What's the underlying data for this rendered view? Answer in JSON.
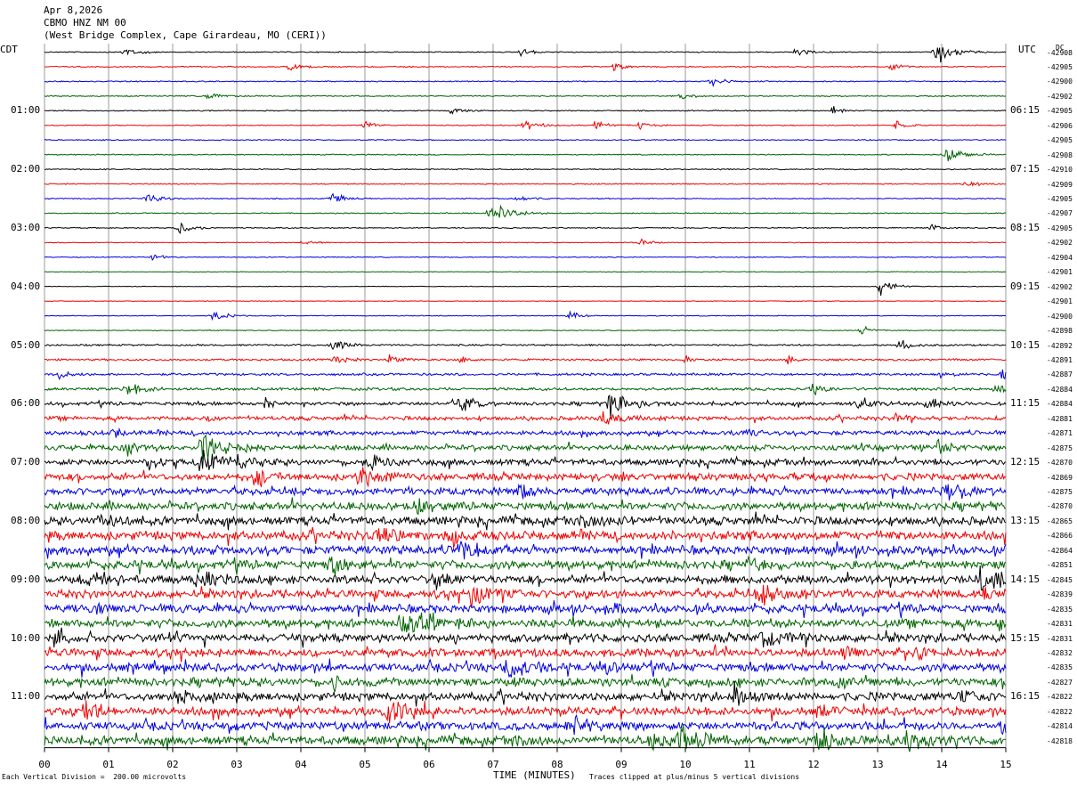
{
  "header": {
    "date": "Apr 8,2026",
    "station": "CBMO HNZ NM 00",
    "location": "(West Bridge Complex, Cape Girardeau, MO (CERI))"
  },
  "labels": {
    "left_tz": "CDT",
    "right_tz": "UTC",
    "dc_header": "DC",
    "xlabel": "TIME (MINUTES)",
    "scale_note": "Each Vertical Division =  200.00 microvolts",
    "clip_note": "Traces clipped at plus/minus 5 vertical divisions"
  },
  "chart_data": {
    "type": "helicorder",
    "xlim": [
      0,
      15
    ],
    "x_ticks": [
      "00",
      "01",
      "02",
      "03",
      "04",
      "05",
      "06",
      "07",
      "08",
      "09",
      "10",
      "11",
      "12",
      "13",
      "14",
      "15"
    ],
    "left_time_labels": [
      "01:00",
      "02:00",
      "03:00",
      "04:00",
      "05:00",
      "06:00",
      "07:00",
      "08:00",
      "09:00",
      "10:00",
      "11:00"
    ],
    "right_time_labels": [
      "06:15",
      "07:15",
      "08:15",
      "09:15",
      "10:15",
      "11:15",
      "12:15",
      "13:15",
      "14:15",
      "15:15",
      "16:15"
    ],
    "trace_colors": [
      "#000000",
      "#ee0000",
      "#0000dd",
      "#006400"
    ],
    "dc_offsets": [
      "-42908",
      "-42905",
      "-42900",
      "-42902",
      "-42905",
      "-42906",
      "-42905",
      "-42908",
      "-42910",
      "-42909",
      "-42905",
      "-42907",
      "-42905",
      "-42902",
      "-42904",
      "-42901",
      "-42902",
      "-42901",
      "-42900",
      "-42898",
      "-42892",
      "-42891",
      "-42887",
      "-42884",
      "-42884",
      "-42881",
      "-42871",
      "-42875",
      "-42870",
      "-42869",
      "-42875",
      "-42870",
      "-42865",
      "-42866",
      "-42864",
      "-42851",
      "-42845",
      "-42839",
      "-42835",
      "-42831",
      "-42831",
      "-42832",
      "-42835",
      "-42827",
      "-42822",
      "-42822",
      "-42814",
      "-42818"
    ],
    "row_activity": [
      0.5,
      0.5,
      0.5,
      0.5,
      0.5,
      0.5,
      0.5,
      0.5,
      0.5,
      0.5,
      0.5,
      0.5,
      0.5,
      0.4,
      0.4,
      0.3,
      0.3,
      0.3,
      0.4,
      0.4,
      0.8,
      0.9,
      1.1,
      1.3,
      1.6,
      1.8,
      2.0,
      2.4,
      2.8,
      3.2,
      3.4,
      3.6,
      3.8,
      4.0,
      4.0,
      4.0,
      3.8,
      3.8,
      3.8,
      3.8,
      3.8,
      3.8,
      3.8,
      3.8,
      3.8,
      3.8,
      3.8,
      4.0
    ],
    "events": [
      {
        "row": 0,
        "x": 1.27,
        "amp": 2,
        "dur": 0.15
      },
      {
        "row": 0,
        "x": 7.45,
        "amp": 1.8,
        "dur": 0.15
      },
      {
        "row": 0,
        "x": 11.75,
        "amp": 1.8,
        "dur": 0.15
      },
      {
        "row": 0,
        "x": 13.95,
        "amp": 5,
        "dur": 0.2
      },
      {
        "row": 1,
        "x": 3.85,
        "amp": 2,
        "dur": 0.15
      },
      {
        "row": 1,
        "x": 8.9,
        "amp": 2,
        "dur": 0.12
      },
      {
        "row": 1,
        "x": 13.2,
        "amp": 1.6,
        "dur": 0.12
      },
      {
        "row": 2,
        "x": 10.4,
        "amp": 2,
        "dur": 0.15
      },
      {
        "row": 3,
        "x": 2.55,
        "amp": 2,
        "dur": 0.12
      },
      {
        "row": 3,
        "x": 9.95,
        "amp": 2,
        "dur": 0.12
      },
      {
        "row": 4,
        "x": 6.35,
        "amp": 1.5,
        "dur": 0.15
      },
      {
        "row": 4,
        "x": 12.3,
        "amp": 1.8,
        "dur": 0.1
      },
      {
        "row": 5,
        "x": 5.0,
        "amp": 2,
        "dur": 0.12
      },
      {
        "row": 5,
        "x": 7.5,
        "amp": 2.5,
        "dur": 0.15
      },
      {
        "row": 5,
        "x": 8.6,
        "amp": 2.4,
        "dur": 0.12
      },
      {
        "row": 5,
        "x": 9.3,
        "amp": 2,
        "dur": 0.12
      },
      {
        "row": 5,
        "x": 13.3,
        "amp": 1.8,
        "dur": 0.12
      },
      {
        "row": 7,
        "x": 14.1,
        "amp": 3.5,
        "dur": 0.2
      },
      {
        "row": 9,
        "x": 14.4,
        "amp": 1.5,
        "dur": 0.15
      },
      {
        "row": 10,
        "x": 1.6,
        "amp": 2.5,
        "dur": 0.15
      },
      {
        "row": 10,
        "x": 4.5,
        "amp": 2.2,
        "dur": 0.15
      },
      {
        "row": 10,
        "x": 7.4,
        "amp": 1.5,
        "dur": 0.15
      },
      {
        "row": 11,
        "x": 7.0,
        "amp": 5,
        "dur": 0.22
      },
      {
        "row": 12,
        "x": 2.1,
        "amp": 3,
        "dur": 0.15
      },
      {
        "row": 12,
        "x": 13.85,
        "amp": 1.5,
        "dur": 0.1
      },
      {
        "row": 13,
        "x": 4.05,
        "amp": 1.5,
        "dur": 0.12
      },
      {
        "row": 13,
        "x": 9.3,
        "amp": 2,
        "dur": 0.12
      },
      {
        "row": 14,
        "x": 1.7,
        "amp": 1.5,
        "dur": 0.12
      },
      {
        "row": 16,
        "x": 13.05,
        "amp": 4,
        "dur": 0.15
      },
      {
        "row": 18,
        "x": 2.65,
        "amp": 2,
        "dur": 0.15
      },
      {
        "row": 18,
        "x": 8.2,
        "amp": 2,
        "dur": 0.12
      },
      {
        "row": 19,
        "x": 12.75,
        "amp": 2,
        "dur": 0.12
      },
      {
        "row": 20,
        "x": 4.5,
        "amp": 2.5,
        "dur": 0.15
      },
      {
        "row": 20,
        "x": 13.35,
        "amp": 2.5,
        "dur": 0.15
      },
      {
        "row": 21,
        "x": 4.55,
        "amp": 2,
        "dur": 0.15
      },
      {
        "row": 21,
        "x": 5.4,
        "amp": 2.2,
        "dur": 0.12
      },
      {
        "row": 21,
        "x": 6.5,
        "amp": 1.5,
        "dur": 0.1
      },
      {
        "row": 21,
        "x": 10.0,
        "amp": 1.5,
        "dur": 0.1
      },
      {
        "row": 21,
        "x": 11.6,
        "amp": 1.8,
        "dur": 0.1
      },
      {
        "row": 22,
        "x": 0.25,
        "amp": 2,
        "dur": 0.12
      },
      {
        "row": 22,
        "x": 14.0,
        "amp": 2,
        "dur": 0.1
      },
      {
        "row": 22,
        "x": 14.95,
        "amp": 2.2,
        "dur": 0.1
      },
      {
        "row": 23,
        "x": 1.3,
        "amp": 2.5,
        "dur": 0.2
      },
      {
        "row": 23,
        "x": 12.0,
        "amp": 2.2,
        "dur": 0.12
      },
      {
        "row": 23,
        "x": 14.85,
        "amp": 2,
        "dur": 0.12
      },
      {
        "row": 24,
        "x": 3.45,
        "amp": 2.2,
        "dur": 0.1
      },
      {
        "row": 24,
        "x": 6.45,
        "amp": 4,
        "dur": 0.2
      },
      {
        "row": 24,
        "x": 8.85,
        "amp": 5,
        "dur": 0.25
      },
      {
        "row": 24,
        "x": 12.7,
        "amp": 2,
        "dur": 0.15
      },
      {
        "row": 24,
        "x": 13.8,
        "amp": 3,
        "dur": 0.15
      },
      {
        "row": 25,
        "x": 2.55,
        "amp": 2,
        "dur": 0.1
      },
      {
        "row": 25,
        "x": 8.7,
        "amp": 2.5,
        "dur": 0.25
      },
      {
        "row": 25,
        "x": 13.3,
        "amp": 1.6,
        "dur": 0.1
      },
      {
        "row": 26,
        "x": 1.1,
        "amp": 2,
        "dur": 0.12
      },
      {
        "row": 26,
        "x": 10.95,
        "amp": 2.2,
        "dur": 0.12
      },
      {
        "row": 27,
        "x": 1.3,
        "amp": 3,
        "dur": 0.2
      },
      {
        "row": 27,
        "x": 2.5,
        "amp": 5,
        "dur": 0.25
      },
      {
        "row": 27,
        "x": 13.95,
        "amp": 3,
        "dur": 0.12
      },
      {
        "row": 28,
        "x": 2.45,
        "amp": 5,
        "dur": 0.3
      },
      {
        "row": 28,
        "x": 1.65,
        "amp": 3,
        "dur": 0.12
      },
      {
        "row": 28,
        "x": 5.05,
        "amp": 3,
        "dur": 0.2
      },
      {
        "row": 28,
        "x": 3.0,
        "amp": 2.5,
        "dur": 0.12
      },
      {
        "row": 29,
        "x": 4.95,
        "amp": 4,
        "dur": 0.2
      },
      {
        "row": 29,
        "x": 3.3,
        "amp": 3,
        "dur": 0.15
      },
      {
        "row": 30,
        "x": 14.1,
        "amp": 5,
        "dur": 0.2
      },
      {
        "row": 30,
        "x": 7.45,
        "amp": 2.5,
        "dur": 0.15
      },
      {
        "row": 31,
        "x": 5.8,
        "amp": 4,
        "dur": 0.15
      },
      {
        "row": 32,
        "x": 8.4,
        "amp": 3,
        "dur": 0.2
      },
      {
        "row": 32,
        "x": 0.9,
        "amp": 2.5,
        "dur": 0.15
      },
      {
        "row": 33,
        "x": 5.2,
        "amp": 5,
        "dur": 0.2
      },
      {
        "row": 33,
        "x": 6.3,
        "amp": 3,
        "dur": 0.15
      },
      {
        "row": 34,
        "x": 6.55,
        "amp": 4,
        "dur": 0.25
      },
      {
        "row": 35,
        "x": 4.5,
        "amp": 3,
        "dur": 0.15
      },
      {
        "row": 35,
        "x": 11.0,
        "amp": 3,
        "dur": 0.15
      },
      {
        "row": 36,
        "x": 0.7,
        "amp": 3,
        "dur": 0.15
      },
      {
        "row": 36,
        "x": 2.4,
        "amp": 3.5,
        "dur": 0.2
      },
      {
        "row": 36,
        "x": 6.1,
        "amp": 3,
        "dur": 0.15
      },
      {
        "row": 36,
        "x": 14.6,
        "amp": 4,
        "dur": 0.2
      },
      {
        "row": 37,
        "x": 6.7,
        "amp": 5,
        "dur": 0.2
      },
      {
        "row": 37,
        "x": 11.2,
        "amp": 4,
        "dur": 0.25
      },
      {
        "row": 37,
        "x": 14.6,
        "amp": 3,
        "dur": 0.12
      },
      {
        "row": 38,
        "x": 8.85,
        "amp": 2.5,
        "dur": 0.15
      },
      {
        "row": 38,
        "x": 0.8,
        "amp": 2,
        "dur": 0.15
      },
      {
        "row": 39,
        "x": 5.65,
        "amp": 5,
        "dur": 0.35
      },
      {
        "row": 39,
        "x": 14.9,
        "amp": 3,
        "dur": 0.12
      },
      {
        "row": 40,
        "x": 0.15,
        "amp": 2.5,
        "dur": 0.12
      },
      {
        "row": 40,
        "x": 11.2,
        "amp": 3.5,
        "dur": 0.2
      },
      {
        "row": 41,
        "x": 12.5,
        "amp": 3,
        "dur": 0.12
      },
      {
        "row": 41,
        "x": 13.6,
        "amp": 2.2,
        "dur": 0.12
      },
      {
        "row": 42,
        "x": 7.25,
        "amp": 4.5,
        "dur": 0.2
      },
      {
        "row": 42,
        "x": 8.8,
        "amp": 3,
        "dur": 0.12
      },
      {
        "row": 43,
        "x": 4.5,
        "amp": 3,
        "dur": 0.12
      },
      {
        "row": 43,
        "x": 12.4,
        "amp": 3,
        "dur": 0.2
      },
      {
        "row": 44,
        "x": 2.1,
        "amp": 3.5,
        "dur": 0.15
      },
      {
        "row": 44,
        "x": 10.8,
        "amp": 4,
        "dur": 0.2
      },
      {
        "row": 44,
        "x": 14.3,
        "amp": 2.5,
        "dur": 0.12
      },
      {
        "row": 45,
        "x": 0.65,
        "amp": 4,
        "dur": 0.2
      },
      {
        "row": 45,
        "x": 5.4,
        "amp": 5,
        "dur": 0.2
      },
      {
        "row": 45,
        "x": 12.1,
        "amp": 2.2,
        "dur": 0.12
      },
      {
        "row": 46,
        "x": 8.3,
        "amp": 4,
        "dur": 0.2
      },
      {
        "row": 46,
        "x": 14.95,
        "amp": 2.2,
        "dur": 0.1
      },
      {
        "row": 47,
        "x": 9.95,
        "amp": 5,
        "dur": 0.3
      },
      {
        "row": 47,
        "x": 12.15,
        "amp": 5,
        "dur": 0.3
      },
      {
        "row": 47,
        "x": 13.5,
        "amp": 3.5,
        "dur": 0.2
      },
      {
        "row": 47,
        "x": 9.5,
        "amp": 3,
        "dur": 0.2
      },
      {
        "row": 47,
        "x": 7.35,
        "amp": 3,
        "dur": 0.15
      }
    ]
  }
}
